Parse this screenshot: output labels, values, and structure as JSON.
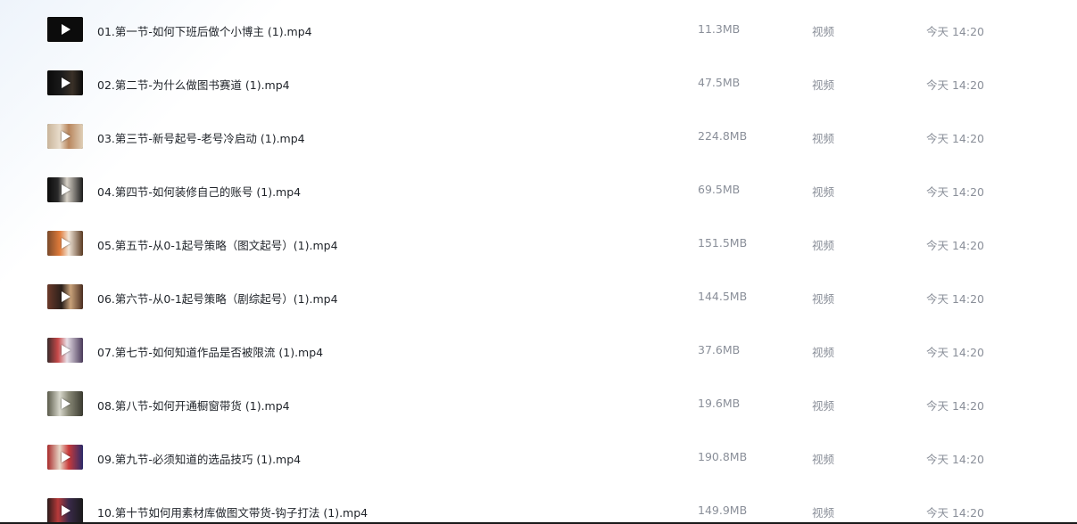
{
  "files": [
    {
      "name": "01.第一节-如何下班后做个小博主 (1).mp4",
      "size": "11.3MB",
      "type": "视频",
      "time": "今天 14:20",
      "thumb_style": "dark"
    },
    {
      "name": "02.第二节-为什么做图书赛道 (1).mp4",
      "size": "47.5MB",
      "type": "视频",
      "time": "今天 14:20",
      "thumb_style": "dark"
    },
    {
      "name": "03.第三节-新号起号-老号冷启动 (1).mp4",
      "size": "224.8MB",
      "type": "视频",
      "time": "今天 14:20",
      "thumb_style": "beige"
    },
    {
      "name": "04.第四节-如何装修自己的账号 (1).mp4",
      "size": "69.5MB",
      "type": "视频",
      "time": "今天 14:20",
      "thumb_style": "dark"
    },
    {
      "name": "05.第五节-从0-1起号策略（图文起号）(1).mp4",
      "size": "151.5MB",
      "type": "视频",
      "time": "今天 14:20",
      "thumb_style": "orange"
    },
    {
      "name": "06.第六节-从0-1起号策略（剧综起号）(1).mp4",
      "size": "144.5MB",
      "type": "视频",
      "time": "今天 14:20",
      "thumb_style": "brown"
    },
    {
      "name": "07.第七节-如何知道作品是否被限流 (1).mp4",
      "size": "37.6MB",
      "type": "视频",
      "time": "今天 14:20",
      "thumb_style": "mixed"
    },
    {
      "name": "08.第八节-如何开通橱窗带货 (1).mp4",
      "size": "19.6MB",
      "type": "视频",
      "time": "今天 14:20",
      "thumb_style": "grey"
    },
    {
      "name": "09.第九节-必须知道的选品技巧 (1).mp4",
      "size": "190.8MB",
      "type": "视频",
      "time": "今天 14:20",
      "thumb_style": "red"
    },
    {
      "name": "10.第十节如何用素材库做图文带货-钩子打法 (1).mp4",
      "size": "149.9MB",
      "type": "视频",
      "time": "今天 14:20",
      "thumb_style": "mixed"
    }
  ],
  "icons": {
    "play": "play-icon"
  },
  "colors": {
    "name_text": "#1f2329",
    "meta_text": "#8a8f99"
  }
}
